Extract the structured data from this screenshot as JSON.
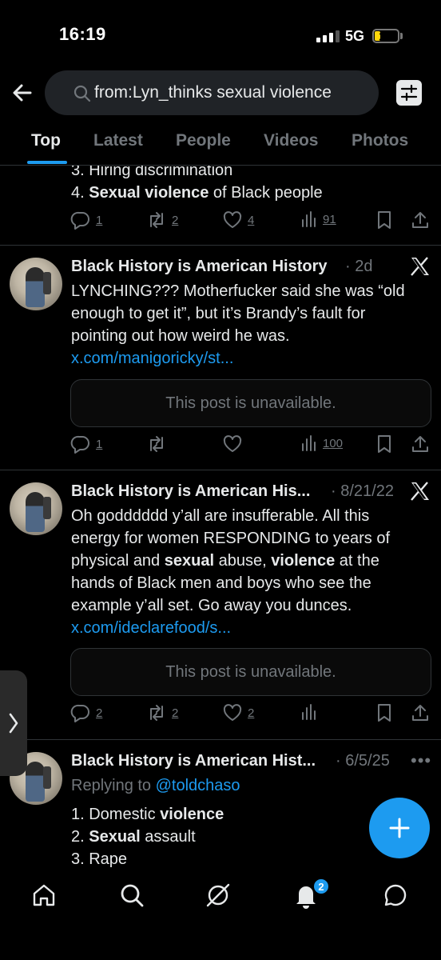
{
  "status_bar": {
    "time": "16:19",
    "network": "5G",
    "battery": "19"
  },
  "search": {
    "query": "from:Lyn_thinks sexual violence"
  },
  "tabs": [
    {
      "label": "Top"
    },
    {
      "label": "Latest"
    },
    {
      "label": "People"
    },
    {
      "label": "Videos"
    },
    {
      "label": "Photos"
    }
  ],
  "post0": {
    "line3": "3. Hiring discrimination",
    "line4_num": "4. ",
    "line4_bold": "Sexual violence",
    "line4_rest": " of Black people",
    "replies": "1",
    "reposts": "2",
    "likes": "4",
    "views": "91"
  },
  "post1": {
    "name": "Black History is American History",
    "meta": "· 2d",
    "text": "LYNCHING??? Motherfucker said she was “old enough to get it”, but it’s Brandy’s fault for pointing out how weird he was. ",
    "link": "x.com/manigoricky/st...",
    "quote": "This post is unavailable.",
    "replies": "1",
    "reposts": "",
    "likes": "",
    "views": "100"
  },
  "post2": {
    "name": "Black History is American His...",
    "meta": "· 8/21/22",
    "text_a": "Oh godddddd y’all are insufferable. All this energy for women RESPONDING to years of physical and ",
    "bold1": "sexual",
    "text_b": " abuse, ",
    "bold2": "violence",
    "text_c": " at the hands of Black men and boys who see the example y’all set. Go away you dunces. ",
    "link": "x.com/ideclarefood/s...",
    "quote": "This post is unavailable.",
    "replies": "2",
    "reposts": "2",
    "likes": "2",
    "views": ""
  },
  "post3": {
    "name": "Black History is American Hist...",
    "meta": "· 6/5/25",
    "replying_prefix": "Replying to ",
    "replying_handle": "@toldchaso",
    "l1_num": "1. Domestic ",
    "l1_bold": "violence",
    "l2_num": "2. ",
    "l2_bold": "Sexual",
    "l2_rest": " assault",
    "l3": "3. Rape"
  },
  "nav": {
    "notifications_badge": "2"
  },
  "colors": {
    "accent": "#1d9bf0",
    "background": "#000000",
    "muted": "#71767b",
    "divider": "#2f3336"
  }
}
